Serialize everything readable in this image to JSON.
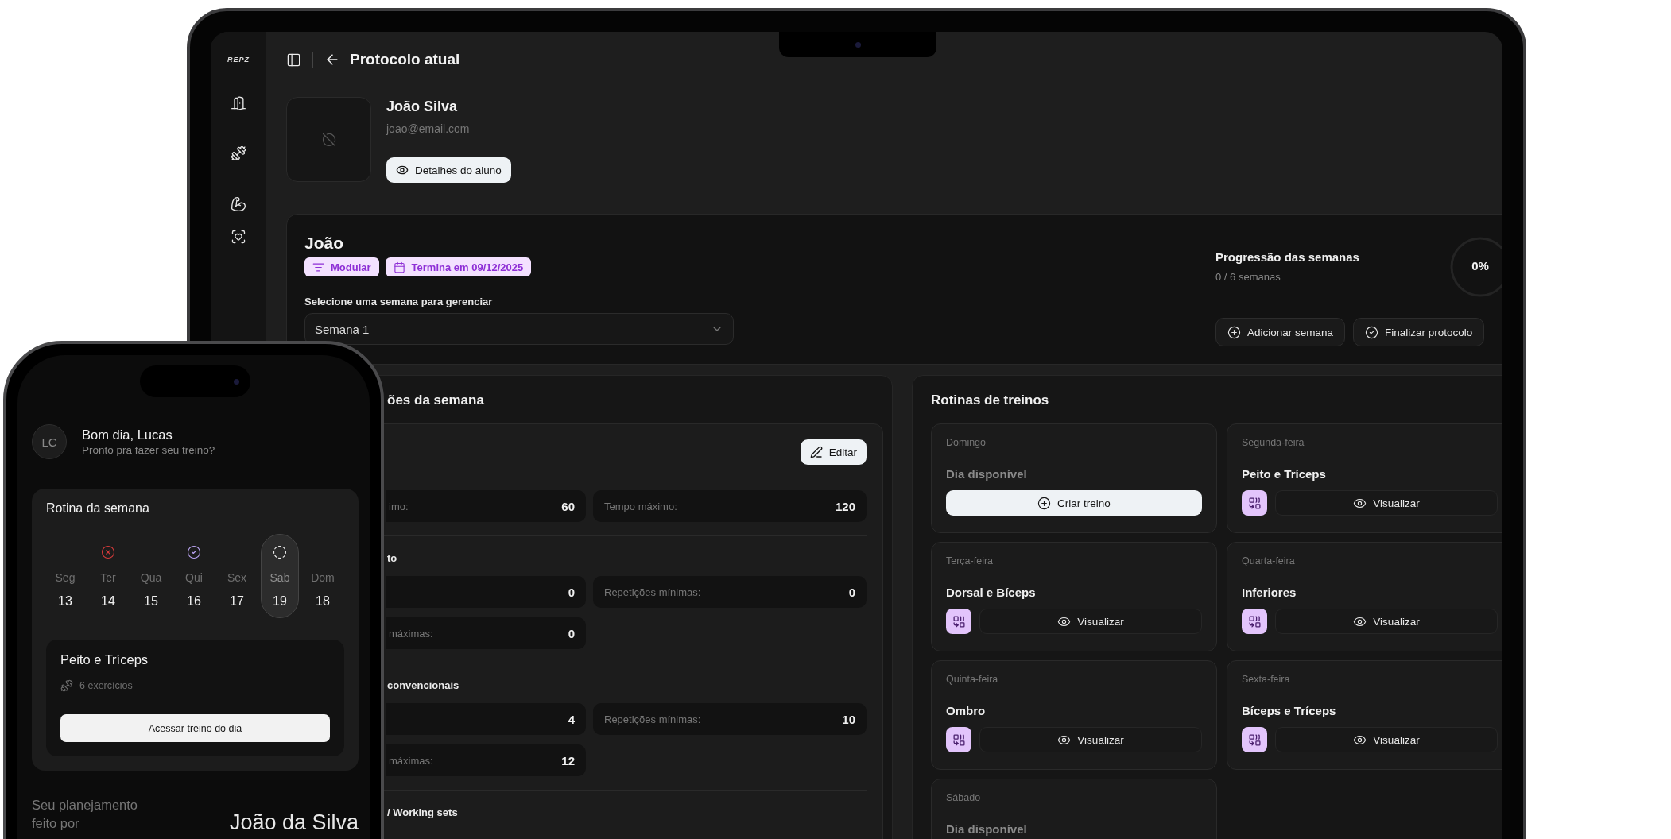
{
  "laptop": {
    "sidebar": {
      "logo": "REPZ"
    },
    "header": {
      "title": "Protocolo atual"
    },
    "student": {
      "name": "João Silva",
      "email": "joao@email.com",
      "details_button": "Detalhes do aluno"
    },
    "protocol": {
      "name": "João",
      "tags": [
        {
          "kind": "type",
          "label": "Modular"
        },
        {
          "kind": "date",
          "label": "Termina em 09/12/2025"
        }
      ],
      "week_label": "Selecione uma semana para gerenciar",
      "week_select": {
        "value": "Semana 1"
      },
      "progress": {
        "title": "Progressão das semanas",
        "subtitle": "0 / 6 semanas",
        "reading": "0%"
      },
      "buttons": [
        {
          "kind": "add",
          "label": "Adicionar semana"
        },
        {
          "kind": "finish",
          "label": "Finalizar protocolo"
        }
      ]
    },
    "week_settings": {
      "title": "ões da semana",
      "edit_button": "Editar",
      "sections": [
        {
          "rows": [
            [
              {
                "label": "imo:",
                "value": "60"
              },
              {
                "label": "Tempo máximo:",
                "value": "120"
              }
            ]
          ]
        },
        {
          "heading": "to",
          "rows": [
            [
              {
                "value": "0"
              },
              {
                "label": "Repetições mínimas:",
                "value": "0"
              }
            ],
            [
              {
                "label": "máximas:",
                "value": "0"
              }
            ]
          ]
        },
        {
          "heading": "convencionais",
          "rows": [
            [
              {
                "value": "4"
              },
              {
                "label": "Repetições mínimas:",
                "value": "10"
              }
            ],
            [
              {
                "label": "máximas:",
                "value": "12"
              }
            ]
          ]
        },
        {
          "heading": "/ Working sets"
        }
      ]
    },
    "routines": {
      "title": "Rotinas de treinos",
      "days": [
        {
          "day": "Domingo",
          "kind": "empty",
          "title": "Dia disponível",
          "action": "Criar treino"
        },
        {
          "day": "Segunda-feira",
          "kind": "workout",
          "title": "Peito e Tríceps",
          "action": "Visualizar"
        },
        {
          "day": "Terça-feira",
          "kind": "workout",
          "title": "Dorsal e Bíceps",
          "action": "Visualizar"
        },
        {
          "day": "Quarta-feira",
          "kind": "workout",
          "title": "Inferiores",
          "action": "Visualizar"
        },
        {
          "day": "Quinta-feira",
          "kind": "workout",
          "title": "Ombro",
          "action": "Visualizar"
        },
        {
          "day": "Sexta-feira",
          "kind": "workout",
          "title": "Bíceps e Tríceps",
          "action": "Visualizar"
        },
        {
          "day": "Sábado",
          "kind": "empty",
          "title": "Dia disponível"
        }
      ]
    }
  },
  "phone": {
    "avatar": "LC",
    "greeting": "Bom dia, Lucas",
    "subtitle": "Pronto pra fazer seu treino?",
    "week": {
      "title": "Rotina da semana",
      "days": [
        {
          "label": "Seg",
          "date": "13",
          "kind": "plain",
          "selected": false
        },
        {
          "label": "Ter",
          "date": "14",
          "kind": "missed",
          "selected": false
        },
        {
          "label": "Qua",
          "date": "15",
          "kind": "plain",
          "selected": false
        },
        {
          "label": "Qui",
          "date": "16",
          "kind": "done",
          "selected": false
        },
        {
          "label": "Sex",
          "date": "17",
          "kind": "plain",
          "selected": false
        },
        {
          "label": "Sab",
          "date": "19",
          "kind": "pending",
          "selected": true
        },
        {
          "label": "Dom",
          "date": "18",
          "kind": "plain",
          "selected": false
        }
      ]
    },
    "today": {
      "title": "Peito e Tríceps",
      "count": "6 exercícios",
      "button": "Acessar treino do dia"
    },
    "footer": {
      "label": "Seu planejamento feito por",
      "coach": "João da Silva"
    }
  }
}
